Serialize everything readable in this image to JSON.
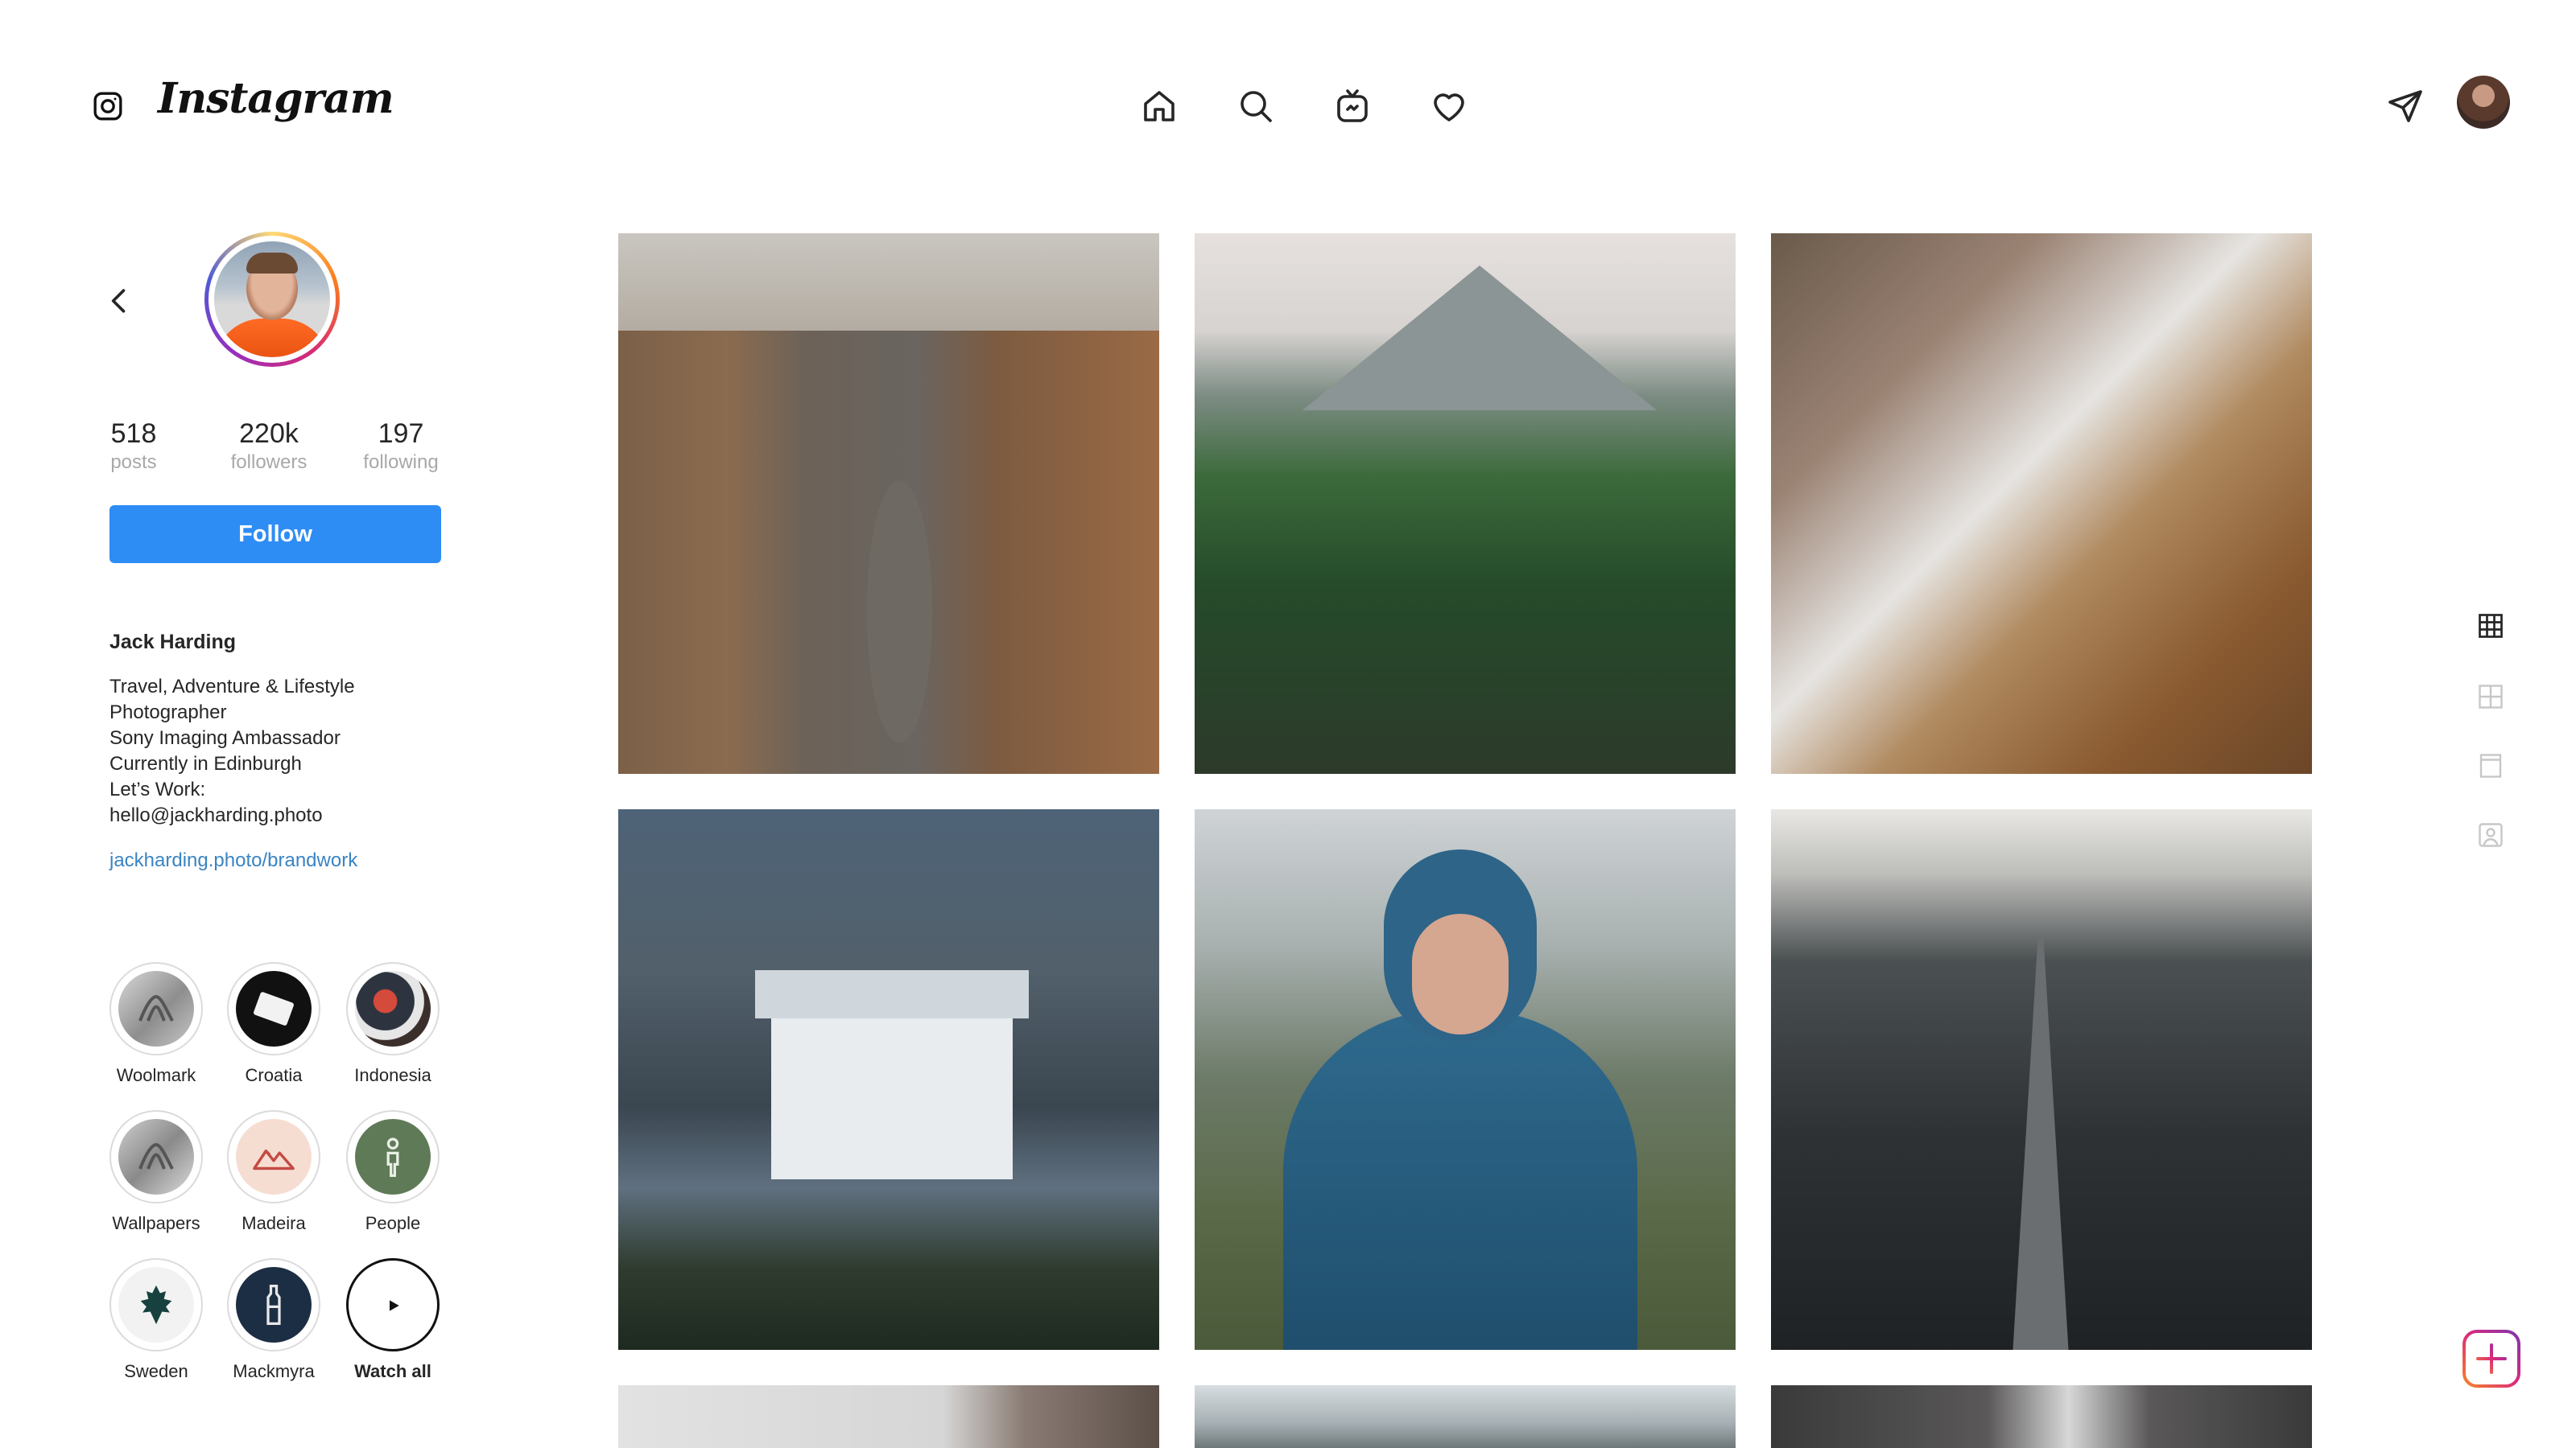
{
  "topbar": {
    "brand": "Instagram",
    "icons": [
      "instagram-glyph-icon",
      "home-icon",
      "search-icon",
      "igtv-icon",
      "heart-icon",
      "direct-message-icon",
      "user-avatar"
    ]
  },
  "profile": {
    "stats": [
      {
        "value": "518",
        "label": "posts"
      },
      {
        "value": "220k",
        "label": "followers"
      },
      {
        "value": "197",
        "label": "following"
      }
    ],
    "follow_label": "Follow",
    "name": "Jack Harding",
    "bio": [
      "Travel, Adventure & Lifestyle",
      "Photographer",
      "Sony Imaging Ambassador",
      "Currently in Edinburgh",
      "Let’s Work:",
      "hello@jackharding.photo"
    ],
    "link": "jackharding.photo/brandwork"
  },
  "highlights": [
    {
      "label": "Woolmark"
    },
    {
      "label": "Croatia"
    },
    {
      "label": "Indonesia"
    },
    {
      "label": "Wallpapers"
    },
    {
      "label": "Madeira"
    },
    {
      "label": "People"
    },
    {
      "label": "Sweden"
    },
    {
      "label": "Mackmyra"
    },
    {
      "label": "Watch all"
    }
  ],
  "grid_posts": [
    "canyon road",
    "volcano over jungle waterfall",
    "hiker on volcanic ridge",
    "white chapel before dolomites",
    "woman in blue hooded jacket",
    "road across black sand",
    "partial post",
    "partial post",
    "partial post"
  ],
  "view_switcher": [
    "grid-icon",
    "grid-outline-icon",
    "reels-icon",
    "tagged-icon"
  ],
  "colors": {
    "accent": "#2e8df5",
    "link": "#3a84c3",
    "muted": "#a8a8a8"
  }
}
